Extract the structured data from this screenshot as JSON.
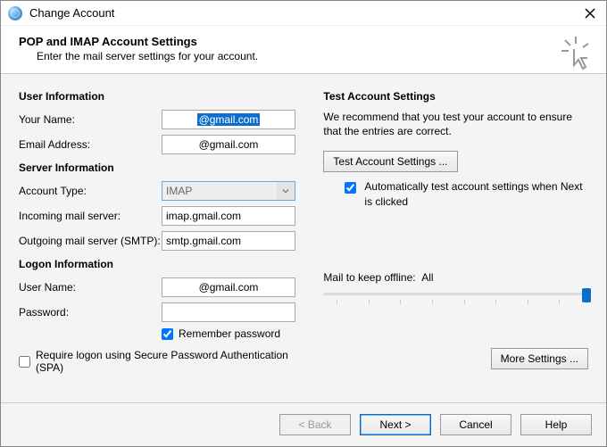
{
  "window": {
    "title": "Change Account"
  },
  "header": {
    "title": "POP and IMAP Account Settings",
    "subtitle": "Enter the mail server settings for your account."
  },
  "left": {
    "user_info_h": "User Information",
    "your_name_lbl": "Your Name:",
    "your_name_val": "@gmail.com",
    "email_lbl": "Email Address:",
    "email_val": "@gmail.com",
    "server_info_h": "Server Information",
    "acct_type_lbl": "Account Type:",
    "acct_type_val": "IMAP",
    "incoming_lbl": "Incoming mail server:",
    "incoming_val": "imap.gmail.com",
    "outgoing_lbl": "Outgoing mail server (SMTP):",
    "outgoing_val": "smtp.gmail.com",
    "logon_h": "Logon Information",
    "user_lbl": "User Name:",
    "user_val": "@gmail.com",
    "pass_lbl": "Password:",
    "pass_val": "",
    "remember_lbl": "Remember password",
    "spa_lbl": "Require logon using Secure Password Authentication (SPA)"
  },
  "right": {
    "test_h": "Test Account Settings",
    "test_desc": "We recommend that you test your account to ensure that the entries are correct.",
    "test_btn": "Test Account Settings ...",
    "auto_test_lbl": "Automatically test account settings when Next is clicked",
    "mail_keep_lbl": "Mail to keep offline:",
    "mail_keep_val": "All",
    "more_btn": "More Settings ..."
  },
  "footer": {
    "back": "< Back",
    "next": "Next >",
    "cancel": "Cancel",
    "help": "Help"
  }
}
